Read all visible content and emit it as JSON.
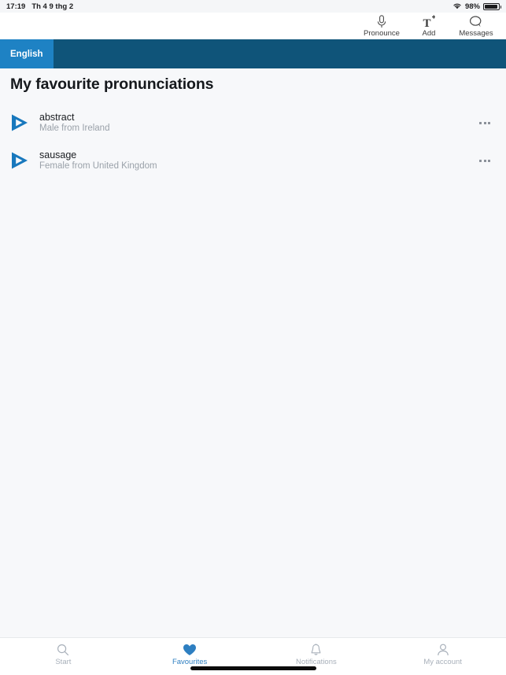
{
  "status_bar": {
    "time": "17:19",
    "date": "Th 4 9 thg 2",
    "wifi_icon": "wifi-icon",
    "battery_percent": "98%",
    "battery_icon": "battery-icon"
  },
  "toolbar": {
    "items": [
      {
        "label": "Pronounce",
        "icon": "microphone-icon"
      },
      {
        "label": "Add",
        "icon": "add-text-icon"
      },
      {
        "label": "Messages",
        "icon": "speech-bubble-icon"
      }
    ]
  },
  "language_bar": {
    "active_tab": "English",
    "background_color": "#0f5479",
    "tab_color": "#1e82c4"
  },
  "page": {
    "title": "My favourite pronunciations"
  },
  "favourites": {
    "rows": [
      {
        "word": "abstract",
        "speaker": "Male from Ireland",
        "play_icon": "play-triangle-icon",
        "menu_icon": "more-options-icon"
      },
      {
        "word": "sausage",
        "speaker": "Female from United Kingdom",
        "play_icon": "play-triangle-icon",
        "menu_icon": "more-options-icon"
      }
    ]
  },
  "bottom_nav": {
    "active_color": "#2e7fc1",
    "inactive_color": "#a8b0ba",
    "items": [
      {
        "label": "Start",
        "icon": "search-icon",
        "active": false
      },
      {
        "label": "Favourites",
        "icon": "heart-icon",
        "active": true
      },
      {
        "label": "Notifications",
        "icon": "bell-icon",
        "active": false
      },
      {
        "label": "My account",
        "icon": "person-icon",
        "active": false
      }
    ]
  }
}
